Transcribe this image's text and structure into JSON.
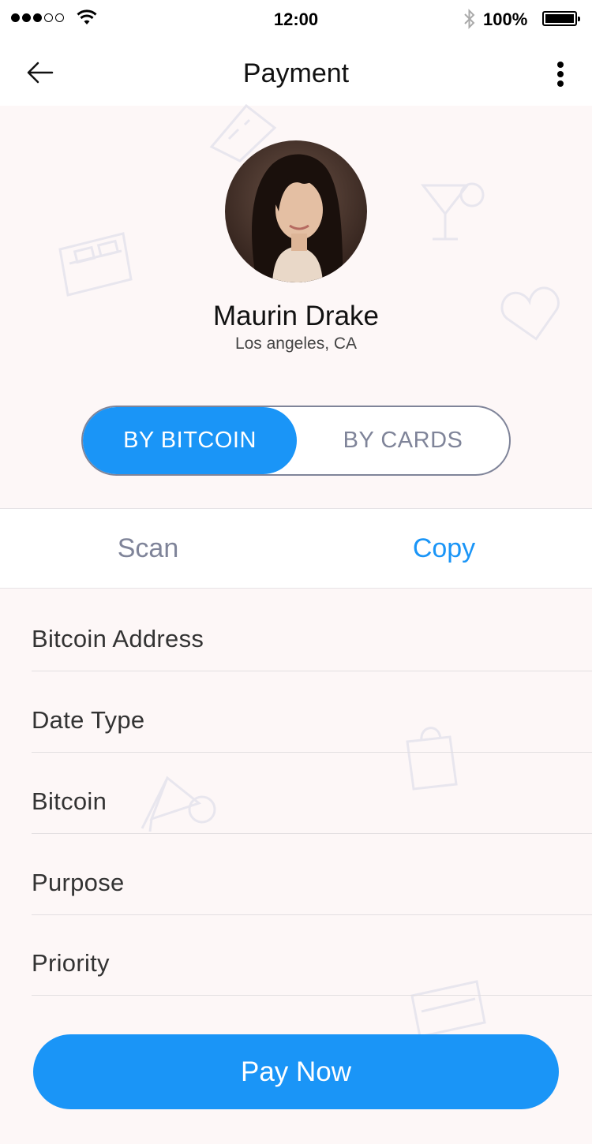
{
  "status_bar": {
    "time": "12:00",
    "battery": "100%"
  },
  "header": {
    "title": "Payment"
  },
  "profile": {
    "name": "Maurin Drake",
    "location": "Los angeles, CA"
  },
  "payment_method": {
    "options": [
      "BY BITCOIN",
      "BY CARDS"
    ],
    "selected": "BY BITCOIN"
  },
  "tabs": {
    "items": [
      "Scan",
      "Copy"
    ],
    "active": "Copy"
  },
  "form": {
    "fields": [
      "Bitcoin Address",
      "Date Type",
      "Bitcoin",
      "Purpose",
      "Priority"
    ]
  },
  "actions": {
    "pay_label": "Pay Now"
  },
  "colors": {
    "accent": "#1a95f7",
    "muted": "#7f8499",
    "background": "#fdf7f7"
  },
  "icons": [
    "signal-icon",
    "wifi-icon",
    "bluetooth-icon",
    "battery-icon",
    "back-arrow-icon",
    "more-vertical-icon"
  ]
}
